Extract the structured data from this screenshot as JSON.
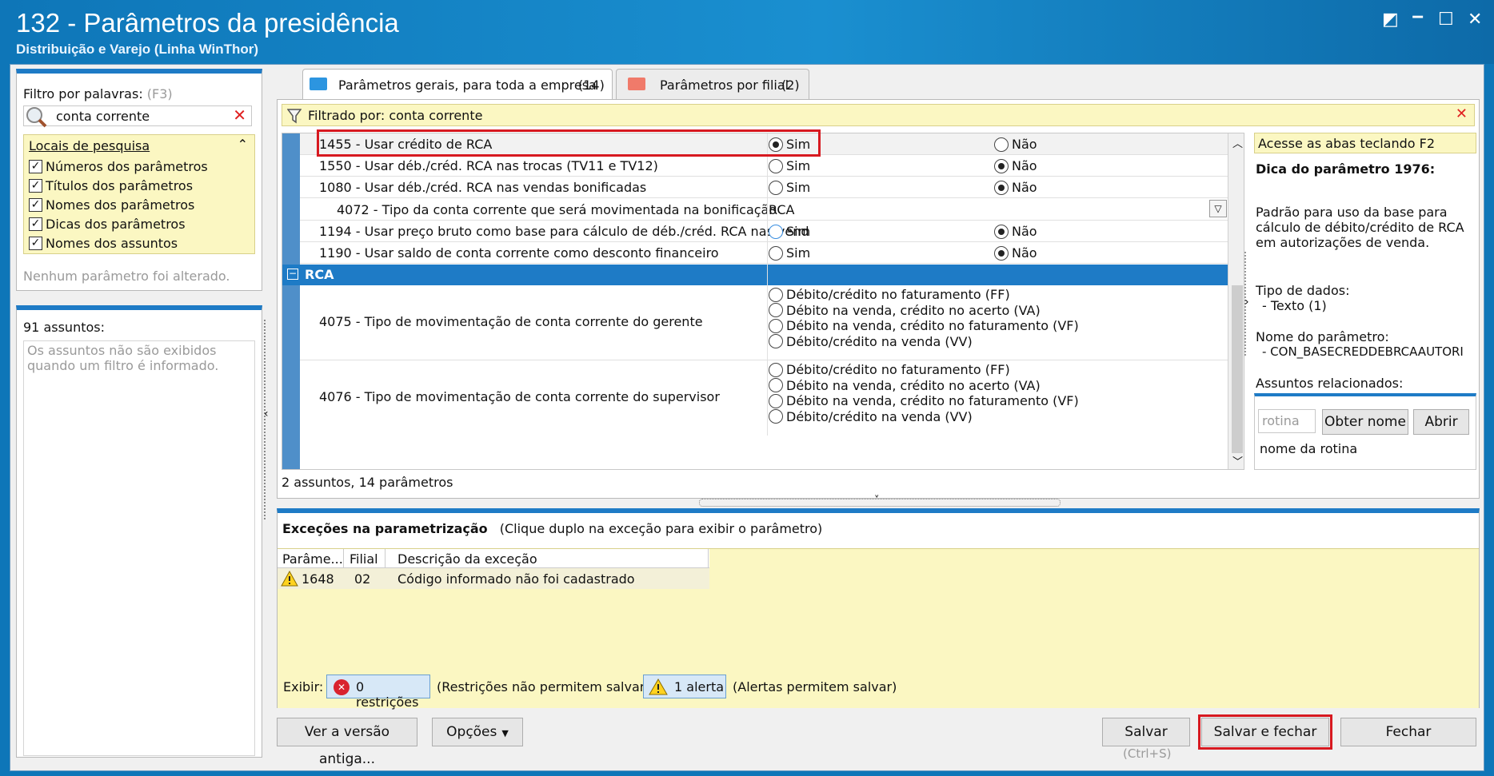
{
  "window": {
    "title": "132 - Parâmetros da presidência",
    "subtitle": "Distribuição e Varejo (Linha WinThor)",
    "controls": [
      "restore",
      "minimize",
      "maximize",
      "close"
    ]
  },
  "left": {
    "filter_label": "Filtro por palavras:",
    "filter_hint": "(F3)",
    "filter_value": "conta corrente",
    "locais_title": "Locais de pesquisa",
    "locais": [
      "Números dos parâmetros",
      "Títulos dos parâmetros",
      "Nomes dos parâmetros",
      "Dicas dos parâmetros",
      "Nomes dos assuntos"
    ],
    "no_change": "Nenhum parâmetro foi alterado.",
    "assuntos_title": "91 assuntos:",
    "assuntos_note": "Os assuntos não são exibidos quando um filtro é informado."
  },
  "tabs": [
    {
      "label": "Parâmetros gerais, para toda a empresa",
      "count": "(14)"
    },
    {
      "label": "Parâmetros por filial",
      "count": "(2)"
    }
  ],
  "filter_bar": "Filtrado por: conta corrente",
  "params": [
    {
      "label": "1455 - Usar crédito de RCA",
      "yes": "Sim",
      "no": "Não",
      "selected": "yes"
    },
    {
      "label": "1550 - Usar déb./créd. RCA nas trocas (TV11 e TV12)",
      "yes": "Sim",
      "no": "Não",
      "selected": "no"
    },
    {
      "label": "1080 - Usar déb./créd. RCA nas vendas bonificadas",
      "yes": "Sim",
      "no": "Não",
      "selected": "no"
    },
    {
      "label": "4072 - Tipo da conta corrente que será movimentada na bonificação",
      "value": "RCA"
    },
    {
      "label": "1194 - Usar preço bruto como base para cálculo de déb./créd. RCA nas vend",
      "yes": "Sim",
      "no": "Não",
      "selected": "no"
    },
    {
      "label": "1190 - Usar saldo de conta corrente como desconto financeiro",
      "yes": "Sim",
      "no": "Não",
      "selected": "no"
    }
  ],
  "group": "RCA",
  "group_params": [
    {
      "label": "4075 - Tipo de movimentação de conta corrente do gerente",
      "options": [
        "Débito/crédito no faturamento (FF)",
        "Débito na venda, crédito no acerto (VA)",
        "Débito na venda, crédito no faturamento (VF)",
        "Débito/crédito na venda (VV)"
      ]
    },
    {
      "label": "4076 - Tipo de movimentação de conta corrente do supervisor",
      "options": [
        "Débito/crédito no faturamento (FF)",
        "Débito na venda, crédito no acerto (VA)",
        "Débito na venda, crédito no faturamento (VF)",
        "Débito/crédito na venda (VV)"
      ]
    }
  ],
  "summary": "2 assuntos, 14 parâmetros",
  "right": {
    "hint": "Acesse as abas teclando F2",
    "dica_title": "Dica do parâmetro 1976:",
    "dica_text": "Padrão para uso da base para cálculo de débito/crédito de RCA em autorizações de venda.",
    "tipo_label": "Tipo de dados:",
    "tipo_value": "- Texto (1)",
    "nome_label": "Nome do parâmetro:",
    "nome_value": "- CON_BASECREDDEBRCAAUTORI",
    "assuntos_label": "Assuntos relacionados:",
    "rotina_placeholder": "rotina",
    "obter_nome": "Obter nome",
    "abrir": "Abrir",
    "nome_rotina": "nome da rotina"
  },
  "exceptions": {
    "title": "Exceções na parametrização",
    "subtitle": "(Clique duplo na exceção para exibir o parâmetro)",
    "columns": [
      "Parâme...",
      "Filial",
      "Descrição da exceção"
    ],
    "rows": [
      {
        "param": "1648",
        "filial": "02",
        "desc": "Código informado não foi cadastrado"
      }
    ]
  },
  "exibir": {
    "label": "Exibir:",
    "restricoes": "0 restrições",
    "restricoes_note": "(Restrições não permitem salvar)",
    "alertas": "1 alerta",
    "alertas_note": "(Alertas permitem salvar)"
  },
  "buttons": {
    "versao": "Ver a versão antiga...",
    "opcoes": "Opções",
    "salvar": "Salvar",
    "salvar_hint": "(Ctrl+S)",
    "salvar_fechar": "Salvar e fechar",
    "fechar": "Fechar"
  }
}
